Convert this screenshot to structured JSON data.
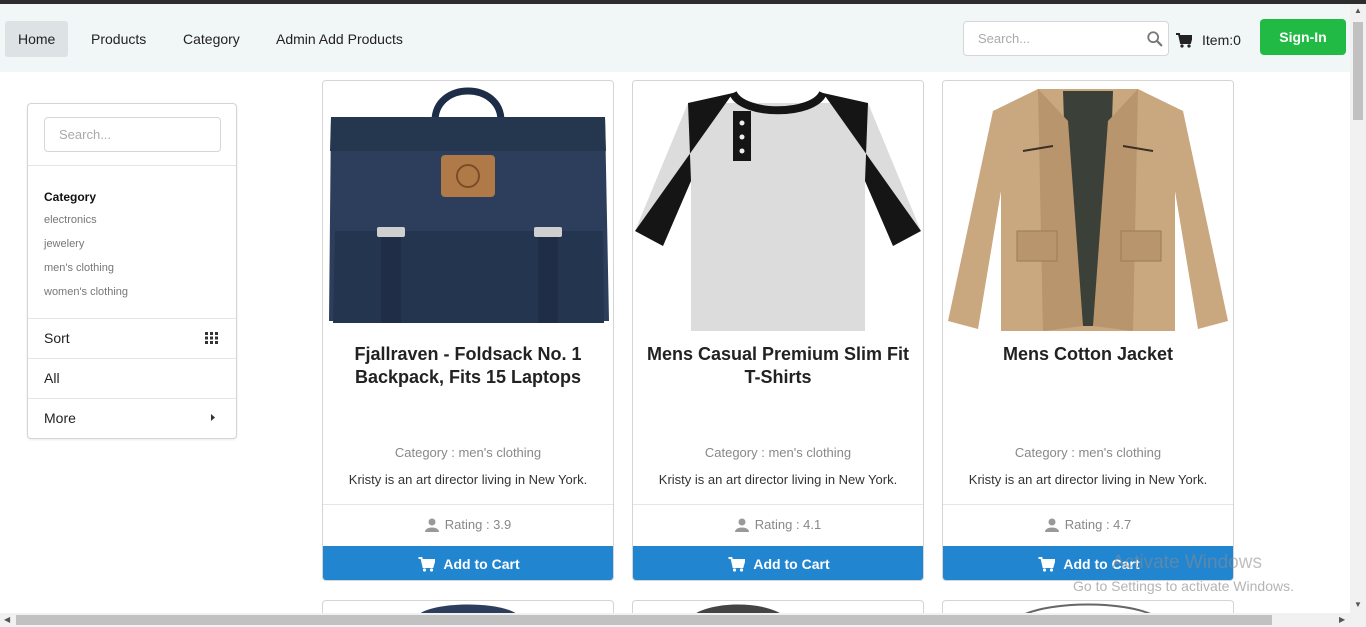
{
  "nav": {
    "items": [
      "Home",
      "Products",
      "Category",
      "Admin Add Products"
    ],
    "search_placeholder": "Search...",
    "cart_label": "Item:0",
    "signin_label": "Sign-In"
  },
  "sidebar": {
    "search_placeholder": "Search...",
    "category_title": "Category",
    "categories": [
      "electronics",
      "jewelery",
      "men's clothing",
      "women's clothing"
    ],
    "sort_label": "Sort",
    "all_label": "All",
    "more_label": "More"
  },
  "products": [
    {
      "title": "Fjallraven - Foldsack No. 1 Backpack, Fits 15 Laptops",
      "category": "Category : men's clothing",
      "description": "Kristy is an art director living in New York.",
      "rating": "Rating : 3.9",
      "button": "Add to Cart"
    },
    {
      "title": "Mens Casual Premium Slim Fit T-Shirts",
      "category": "Category : men's clothing",
      "description": "Kristy is an art director living in New York.",
      "rating": "Rating : 4.1",
      "button": "Add to Cart"
    },
    {
      "title": "Mens Cotton Jacket",
      "category": "Category : men's clothing",
      "description": "Kristy is an art director living in New York.",
      "rating": "Rating : 4.7",
      "button": "Add to Cart"
    }
  ],
  "watermark": {
    "line1": "Activate Windows",
    "line2": "Go to Settings to activate Windows."
  },
  "colors": {
    "signin": "#21ba45",
    "add_to_cart": "#2185d0",
    "navbar_bg": "#f1f6f6"
  }
}
